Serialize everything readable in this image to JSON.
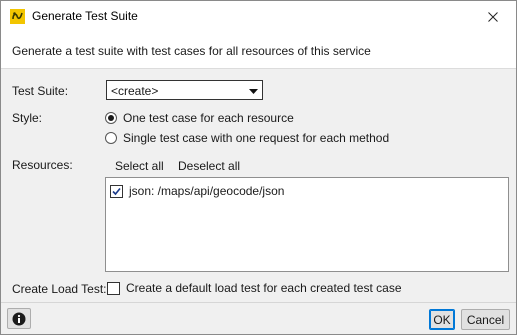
{
  "window": {
    "title": "Generate Test Suite",
    "close_icon": "close-icon",
    "app_icon": "soapui-app-icon"
  },
  "header": {
    "description": "Generate a test suite with test cases for all resources of this service"
  },
  "form": {
    "test_suite": {
      "label": "Test Suite:",
      "selected": "<create>",
      "icon": "dropdown-arrow-icon"
    },
    "style": {
      "label": "Style:",
      "options": [
        {
          "label": "One test case for each resource",
          "checked": true
        },
        {
          "label": "Single test case with one request for each method",
          "checked": false
        }
      ]
    },
    "resources": {
      "label": "Resources:",
      "select_all": "Select all",
      "deselect_all": "Deselect all",
      "items": [
        {
          "label": "json: /maps/api/geocode/json",
          "checked": true
        }
      ]
    },
    "load_test": {
      "label": "Create Load Test:",
      "option_label": "Create a default load test for each created test case",
      "checked": false
    }
  },
  "footer": {
    "help_icon": "info-icon",
    "ok_label": "OK",
    "cancel_label": "Cancel"
  },
  "colors": {
    "accent": "#0078d7",
    "dialog_bg": "#f0f0f0",
    "icon_yellow": "#f2c500",
    "icon_dark": "#3a3a00"
  }
}
